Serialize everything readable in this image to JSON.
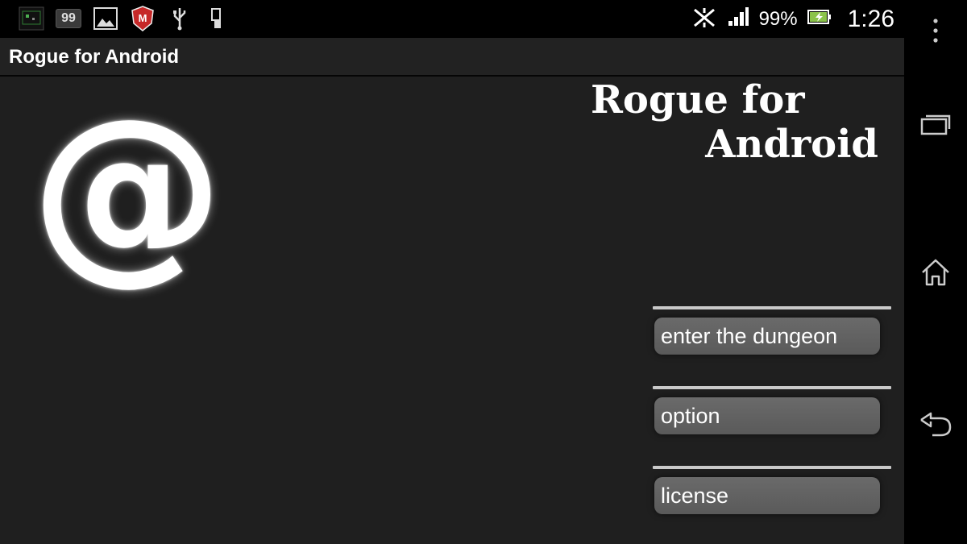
{
  "status_bar": {
    "battery_percent": "99%",
    "time": "1:26",
    "notification_icons": [
      "app-thumbnail-icon",
      "badge-99-icon",
      "gallery-icon",
      "mcafee-icon",
      "usb-icon",
      "usb-debug-icon"
    ],
    "badge_text": "99"
  },
  "action_bar": {
    "title": "Rogue for Android"
  },
  "splash": {
    "symbol": "@",
    "title_line1": "Rogue for",
    "title_line2": "Android"
  },
  "menu": {
    "items": [
      {
        "label": "enter the dungeon"
      },
      {
        "label": "option"
      },
      {
        "label": "license"
      }
    ]
  },
  "nav_bar": {
    "icons": [
      "overflow-menu-icon",
      "recent-apps-icon",
      "home-icon",
      "back-icon"
    ]
  },
  "colors": {
    "background": "#1f1f1f",
    "status_bar": "#000000",
    "button": "#636363",
    "battery_fill": "#8bc34a"
  }
}
